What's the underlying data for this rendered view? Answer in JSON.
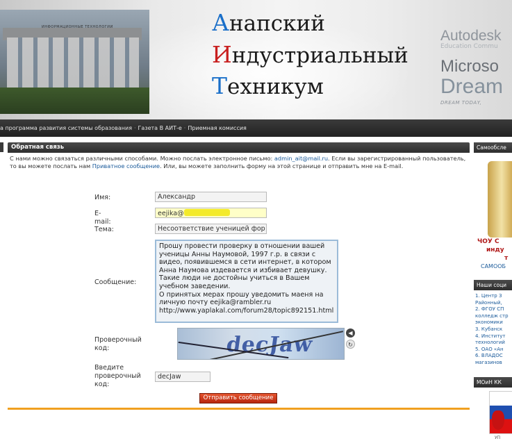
{
  "header": {
    "logo_sign": "ИНФОРМАЦИОННЫЕ ТЕХНОЛОГИИ",
    "title_line1_cap": "А",
    "title_line1_rest": "напский",
    "title_line2_cap": "И",
    "title_line2_rest": "ндустриальный",
    "title_line3_cap": "Т",
    "title_line3_rest": "ехникум",
    "partner_autodesk": "Autodesk",
    "partner_edu": "Education Commu",
    "partner_microsoft": "Microso",
    "partner_dream": "Dream",
    "partner_tagline": "DREAM TODAY, "
  },
  "nav": {
    "items": [
      "а программа развития системы образования",
      "Газета В АИТ-е",
      "Приемная комиссия"
    ],
    "separator": "·"
  },
  "panel": {
    "title": "Обратная связь",
    "intro_1": "С нами можно связаться различными способами. Можно послать электронное письмо: ",
    "intro_email": "admin_ait@mail.ru",
    "intro_2": ". Если вы зарегистрированный пользователь, то вы можете послать нам ",
    "intro_link": "Приватное сообщение",
    "intro_3": ". Или, вы можете заполнить форму на этой странице и отправить мне на E-mail."
  },
  "form": {
    "name_label": "Имя:",
    "name_value": "Александр",
    "email_label": "E-mail:",
    "email_value": "eejika@",
    "subject_label": "Тема:",
    "subject_value": "Несоответствие ученицей фор",
    "message_label": "Сообщение:",
    "message_value": "Прошу провести проверку в отношении вашей ученицы Анны Наумовой, 1997 г.р. в связи с видео, появившемся в сети интернет, в котором Анна Наумова издевается и избивает девушку. Такие люди не достойны учиться в Вашем учебном заведении.\nО принятых мерах прошу уведомить маеня на личную почту eejika@rambler.ru\nhttp://www.yaplakal.com/forum28/topic892151.html",
    "captcha_label_1": "Проверочный",
    "captcha_label_2": "код:",
    "captcha_text": "decJaw",
    "code_label_1": "Введите",
    "code_label_2": "проверочный",
    "code_label_3": "код:",
    "code_value": "decJaw",
    "submit_label": "Отправить сообщение"
  },
  "right": {
    "box1_title": "Самообсле",
    "box1_line1": "ЧОУ С",
    "box1_line2": "инду",
    "box1_line3": "т",
    "box1_link": "САМООБ",
    "box2_title": "Наши соци",
    "box2_items": [
      "1. Центр З",
      "Районный, ",
      "2. ФГОУ СП",
      "колледж стр",
      "экономики",
      "3. Кубанск",
      "4. Институт",
      "технологий",
      "5. ОАО «Ан",
      "6. ВЛАДОС",
      "магазинов"
    ],
    "box3_title": "МОиН КК",
    "box3_caption": "УП"
  },
  "colors": {
    "accent_blue": "#1a6fc9",
    "accent_red": "#c81e1e",
    "panel_header": "#2e2e2e",
    "submit": "#c8361a",
    "panel_bottom_bar": "#f0a020"
  }
}
